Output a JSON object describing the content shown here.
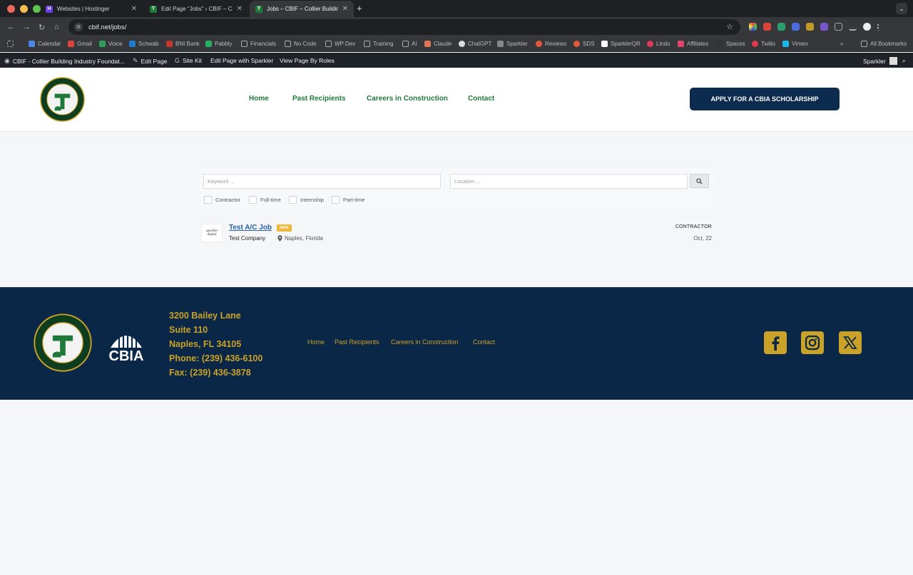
{
  "browser": {
    "tabs": [
      {
        "title": "Websites | Hostinger",
        "active": false
      },
      {
        "title": "Edit Page \"Jobs\" ‹ CBIF – Coll",
        "active": false
      },
      {
        "title": "Jobs – CBIF – Collier Building",
        "active": true
      }
    ],
    "url": "cbif.net/jobs/",
    "bookmarks": [
      "Calendar",
      "Gmail",
      "Voice",
      "Schwab",
      "BNI Bank",
      "Pabbly",
      "Financials",
      "No Code",
      "WP Dev",
      "Training",
      "AI",
      "Claude",
      "ChatGPT",
      "Sparkler",
      "Reviews",
      "SDS",
      "SparklerQR",
      "Lindo",
      "Affiliates",
      "Spaces",
      "Twilio",
      "Vimeo"
    ],
    "all_bookmarks": "All Bookmarks"
  },
  "wp_admin": {
    "site_name": "CBIF - Collier Building Industry Foundat...",
    "edit_page": "Edit Page",
    "site_kit": "Site Kit",
    "edit_with_sparkler": "Edit Page with Sparkler",
    "view_by_roles": "View Page By Roles",
    "user": "Sparkler"
  },
  "header": {
    "nav": [
      "Home",
      "Past Recipients",
      "Careers in Construction",
      "Contact"
    ],
    "apply_button": "APPLY FOR A CBIA SCHOLARSHIP"
  },
  "search": {
    "keyword_placeholder": "Keyword ...",
    "location_placeholder": "Location ...",
    "job_types": [
      "Contractor",
      "Full-time",
      "Internship",
      "Part-time"
    ]
  },
  "jobs": [
    {
      "title": "Test A/C Job",
      "badge": "NEW",
      "company": "Test Company",
      "location": "Naples, Florida",
      "type": "CONTRACTOR",
      "date": "Oct, 22",
      "logo_text": "sparkler digital"
    }
  ],
  "footer": {
    "address": [
      "3200 Bailey Lane",
      "Suite 110",
      "Naples, FL 34105",
      "Phone: (239) 436-6100",
      "Fax: (239) 436-3878"
    ],
    "nav": [
      "Home",
      "Past Recipients",
      "Careers in Construction",
      "Contact"
    ],
    "cbia_label": "CBIA",
    "social": [
      "facebook-icon",
      "instagram-icon",
      "x-icon"
    ]
  },
  "colors": {
    "brand_green": "#1f7a3a",
    "navy": "#0b2748",
    "gold": "#c9a227",
    "button_navy": "#0d2a4f"
  }
}
